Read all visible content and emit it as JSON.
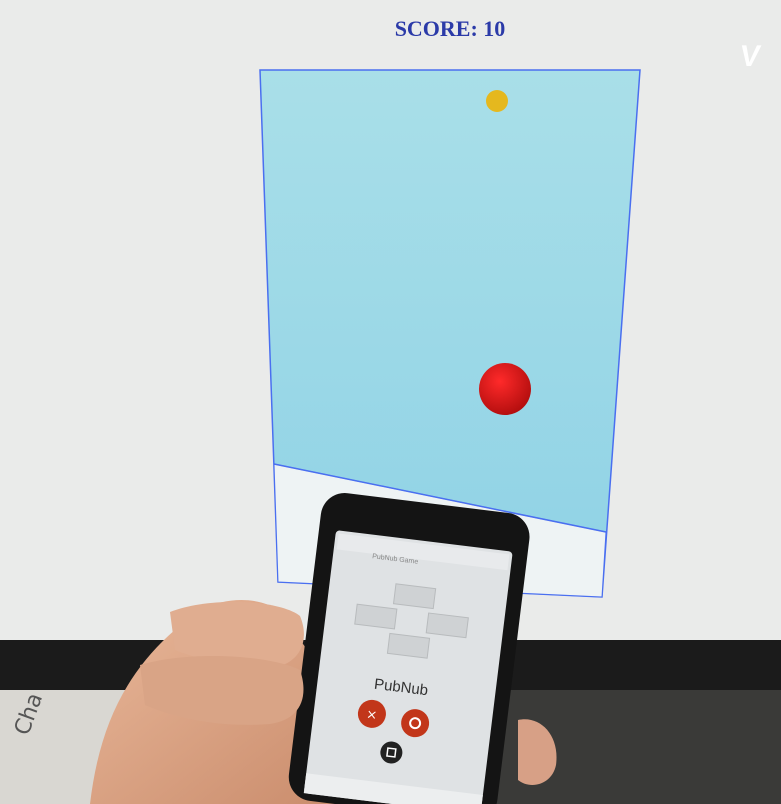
{
  "hud": {
    "score_label": "SCORE: 10"
  },
  "watermark": {
    "logo_text": "V"
  },
  "game_board": {
    "colors": {
      "board_fill_top": "#a9dfe8",
      "board_fill_bottom": "#8fd2e6",
      "border": "#4a6ff0",
      "target_dot": "#e5b81e",
      "player_ball": "#d81818"
    }
  },
  "phone": {
    "app_title": "PubNub Game",
    "brand_label": "PubNub",
    "dpad": [
      "up-arrow-icon",
      "left-arrow-icon",
      "right-arrow-icon",
      "down-arrow-icon"
    ],
    "action_buttons": [
      "x-icon",
      "circle-icon",
      "square-icon"
    ]
  },
  "background_text": {
    "corner": "Cha"
  }
}
